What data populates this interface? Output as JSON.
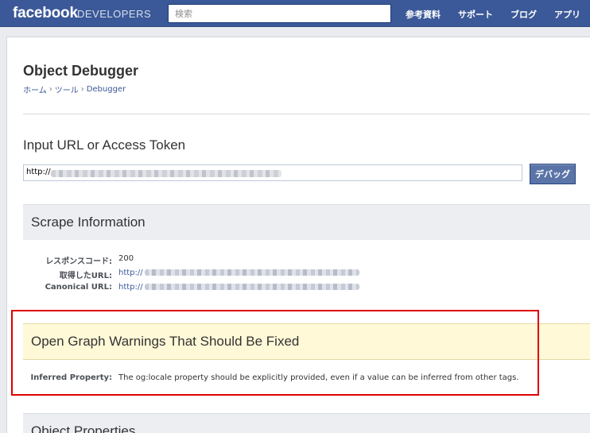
{
  "header": {
    "logo": "facebook",
    "logo_sub": "DEVELOPERS",
    "search_placeholder": "検索",
    "nav": [
      "参考資料",
      "サポート",
      "ブログ",
      "アプリ"
    ]
  },
  "page": {
    "title": "Object Debugger",
    "breadcrumb": [
      "ホーム",
      "ツール",
      "Debugger"
    ]
  },
  "input": {
    "label": "Input URL or Access Token",
    "value_prefix": "http://",
    "button": "デバッグ"
  },
  "scrape": {
    "title": "Scrape Information",
    "rows": [
      {
        "key": "レスポンスコード:",
        "value": "200"
      },
      {
        "key": "取得したURL:",
        "value": "http://"
      },
      {
        "key": "Canonical URL:",
        "value": "http://"
      }
    ]
  },
  "warnings": {
    "title": "Open Graph Warnings That Should Be Fixed",
    "key": "Inferred Property:",
    "value": "The og:locale property should be explicitly provided, even if a value can be inferred from other tags."
  },
  "object_properties": {
    "title": "Object Properties"
  },
  "colors": {
    "topbar": "#3b5998",
    "highlight": "#e00000",
    "warning_bg": "#fff9d7"
  }
}
